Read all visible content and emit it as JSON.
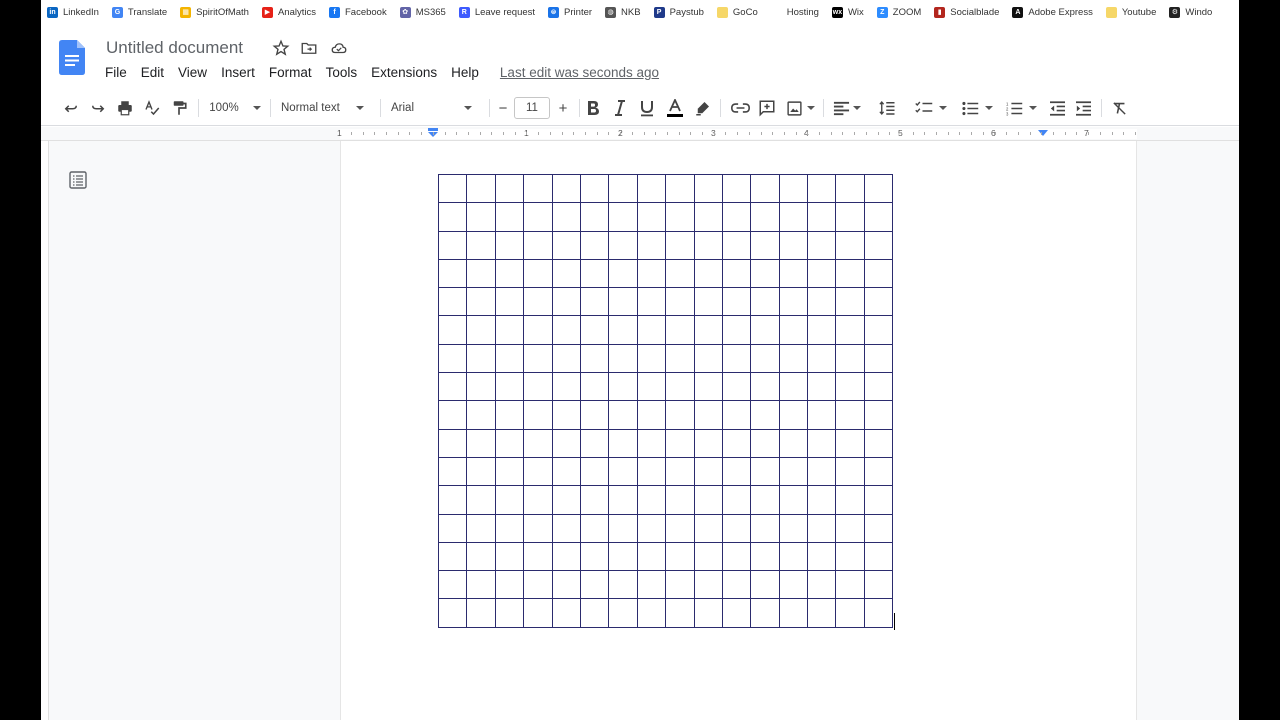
{
  "bookmarks": [
    {
      "label": "LinkedIn",
      "icon": "linkedin-icon",
      "color": "#0a66c2",
      "glyph": "in"
    },
    {
      "label": "Translate",
      "icon": "translate-icon",
      "color": "#4285f4",
      "glyph": "G"
    },
    {
      "label": "SpiritOfMath",
      "icon": "spiritofmath-icon",
      "color": "#f4b400",
      "glyph": "▦"
    },
    {
      "label": "Analytics",
      "icon": "youtube-icon",
      "color": "#e62117",
      "glyph": "▶"
    },
    {
      "label": "Facebook",
      "icon": "facebook-icon",
      "color": "#1877f2",
      "glyph": "f"
    },
    {
      "label": "MS365",
      "icon": "ms365-icon",
      "color": "#6264a7",
      "glyph": "✿"
    },
    {
      "label": "Leave request",
      "icon": "leave-request-icon",
      "color": "#3d5afe",
      "glyph": "R"
    },
    {
      "label": "Printer",
      "icon": "printer-globe-icon",
      "color": "#1a73e8",
      "glyph": "⊜"
    },
    {
      "label": "NKB",
      "icon": "globe-icon",
      "color": "#555555",
      "glyph": "◍"
    },
    {
      "label": "Paystub",
      "icon": "paystub-icon",
      "color": "#1f3a8a",
      "glyph": "P"
    },
    {
      "label": "GoCo",
      "icon": "folder-icon",
      "color": "#f6d768",
      "glyph": ""
    },
    {
      "label": "Hosting",
      "icon": "hosting-icon",
      "color": "#ffffff",
      "glyph": ""
    },
    {
      "label": "Wix",
      "icon": "wix-icon",
      "color": "#000000",
      "glyph": "wx"
    },
    {
      "label": "ZOOM",
      "icon": "zoom-icon",
      "color": "#2d8cff",
      "glyph": "Z"
    },
    {
      "label": "Socialblade",
      "icon": "socialblade-icon",
      "color": "#b3261e",
      "glyph": "▮"
    },
    {
      "label": "Adobe Express",
      "icon": "adobe-express-icon",
      "color": "#111111",
      "glyph": "A"
    },
    {
      "label": "Youtube",
      "icon": "folder-icon",
      "color": "#f6d768",
      "glyph": ""
    },
    {
      "label": "Windo",
      "icon": "windows-gear-icon",
      "color": "#222222",
      "glyph": "⚙"
    }
  ],
  "document": {
    "title": "Untitled document",
    "menu": [
      "File",
      "Edit",
      "View",
      "Insert",
      "Format",
      "Tools",
      "Extensions",
      "Help"
    ],
    "last_edit": "Last edit was seconds ago"
  },
  "toolbar": {
    "zoom": "100%",
    "style": "Normal text",
    "font": "Arial",
    "font_size": "11",
    "minus": "−",
    "plus": "+"
  },
  "ruler_numbers": [
    "1",
    "1",
    "2",
    "3",
    "4",
    "5",
    "6",
    "7"
  ],
  "table": {
    "rows": 16,
    "cols": 16
  },
  "colors": {
    "accent": "#4285f4",
    "table_border": "#2b2b6e",
    "canvas": "#f8f9fa"
  }
}
